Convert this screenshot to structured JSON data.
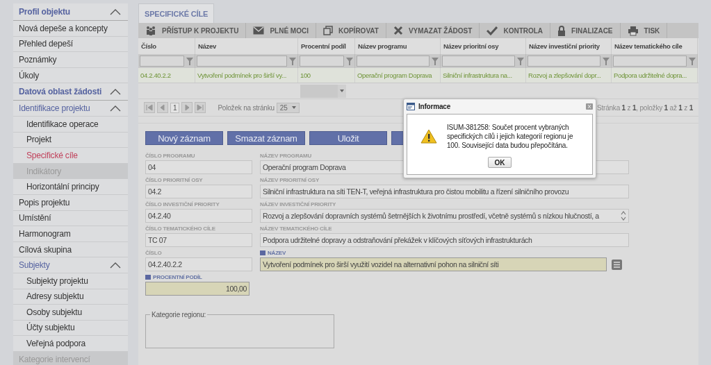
{
  "sidebar": {
    "items": [
      {
        "label": "Profil objektu",
        "kind": "header",
        "expanded": true,
        "children": [
          {
            "label": "Nová depeše a koncepty",
            "selected": false,
            "disabled": false
          },
          {
            "label": "Přehled depeší",
            "selected": false,
            "disabled": false
          },
          {
            "label": "Poznámky",
            "selected": false,
            "disabled": false
          },
          {
            "label": "Úkoly",
            "selected": false,
            "disabled": false
          }
        ]
      },
      {
        "label": "Datová oblast žádosti",
        "kind": "header",
        "expanded": true,
        "children": [
          {
            "label": "Identifikace projektu",
            "kind": "group",
            "expanded": true,
            "children": [
              {
                "label": "Identifikace operace",
                "selected": false,
                "disabled": false
              },
              {
                "label": "Projekt",
                "selected": false,
                "disabled": false
              },
              {
                "label": "Specifické cíle",
                "selected": true,
                "disabled": false
              },
              {
                "label": "Indikátory",
                "selected": false,
                "disabled": true
              },
              {
                "label": "Horizontální principy",
                "selected": false,
                "disabled": false
              }
            ]
          },
          {
            "label": "Popis projektu",
            "selected": false,
            "disabled": false
          },
          {
            "label": "Umístění",
            "selected": false,
            "disabled": false
          },
          {
            "label": "Harmonogram",
            "selected": false,
            "disabled": false
          },
          {
            "label": "Cílová skupina",
            "selected": false,
            "disabled": false
          },
          {
            "label": "Subjekty",
            "kind": "group",
            "expanded": true,
            "children": [
              {
                "label": "Subjekty projektu",
                "selected": false,
                "disabled": false
              },
              {
                "label": "Adresy subjektu",
                "selected": false,
                "disabled": false
              },
              {
                "label": "Osoby subjektu",
                "selected": false,
                "disabled": false
              },
              {
                "label": "Účty subjektu",
                "selected": false,
                "disabled": false
              },
              {
                "label": "Veřejná podpora",
                "selected": false,
                "disabled": false
              }
            ]
          },
          {
            "label": "Kategorie intervencí",
            "selected": false,
            "disabled": true
          }
        ]
      }
    ]
  },
  "tab": {
    "label": "SPECIFICKÉ CÍLE",
    "selected": true
  },
  "toolbar": [
    {
      "label": "PŘÍSTUP K PROJEKTU"
    },
    {
      "label": "PLNÉ MOCI"
    },
    {
      "label": "KOPÍROVAT"
    },
    {
      "label": "VYMAZAT ŽÁDOST"
    },
    {
      "label": "KONTROLA"
    },
    {
      "label": "FINALIZACE"
    },
    {
      "label": "TISK"
    }
  ],
  "table": {
    "columns": [
      "Číslo",
      "Název",
      "Procentní podíl",
      "Název programu",
      "Název prioritní osy",
      "Název investiční priority",
      "Název tematického cíle"
    ],
    "rows": [
      {
        "selected": true,
        "cells": [
          "04.2.40.2.2",
          "Vytvoření podmínek pro širší vy...",
          "100",
          "Operační program Doprava",
          "Silniční infrastruktura na...",
          "Rozvoj a zlepšování dopr...",
          "Podpora udržitelné dopra..."
        ]
      }
    ]
  },
  "pager": {
    "page": "1",
    "page_size_label": "Položek na stránku",
    "page_size": "25",
    "summary": "Stránka **1** z **1**, položky **1** až **1** z **1**"
  },
  "buttons": [
    "Nový záznam",
    "Smazat záznam",
    "Uložit"
  ],
  "form": {
    "rows": [
      [
        {
          "label": "ČÍSLO PROGRAMU",
          "value": "04",
          "required": false,
          "highlighted": false,
          "kind": "text"
        },
        {
          "label": "NÁZEV PROGRAMU",
          "value": "Operační program Doprava",
          "required": false,
          "highlighted": false,
          "kind": "text"
        }
      ],
      [
        {
          "label": "ČÍSLO PRIORITNÍ OSY",
          "value": "04.2",
          "required": false,
          "highlighted": false,
          "kind": "text"
        },
        {
          "label": "NÁZEV PRIORITNÍ OSY",
          "value": "Silniční infrastruktura na síti TEN-T, veřejná infrastruktura pro čistou mobilitu a řízení silničního provozu",
          "required": false,
          "highlighted": false,
          "kind": "text"
        }
      ],
      [
        {
          "label": "ČÍSLO INVESTIČNÍ PRIORITY",
          "value": "04.2.40",
          "required": false,
          "highlighted": false,
          "kind": "text"
        },
        {
          "label": "NÁZEV INVESTIČNÍ PRIORITY",
          "value": "Rozvoj a zlepšování dopravních systémů šetrnějších k životnímu prostředí, včetně systémů s nízkou hlučností, a",
          "required": false,
          "highlighted": false,
          "kind": "textarea"
        }
      ],
      [
        {
          "label": "ČÍSLO TEMATICKÉHO CÍLE",
          "value": "TC 07",
          "required": false,
          "highlighted": false,
          "kind": "text"
        },
        {
          "label": "NÁZEV TEMATICKÉHO CÍLE",
          "value": "Podpora udržitelné dopravy a odstraňování překážek v klíčových síťových infrastrukturách",
          "required": false,
          "highlighted": false,
          "kind": "text"
        }
      ],
      [
        {
          "label": "ČÍSLO",
          "value": "04.2.40.2.2",
          "required": false,
          "highlighted": false,
          "kind": "text"
        },
        {
          "label": "NÁZEV",
          "value": "Vytvoření podmínek pro širší využití vozidel na alternativní pohon na silniční síti",
          "required": true,
          "highlighted": true,
          "kind": "picker"
        }
      ],
      [
        {
          "label": "PROCENTNÍ PODÍL",
          "value": "100,00",
          "required": true,
          "highlighted": true,
          "kind": "number"
        }
      ]
    ],
    "region_group": {
      "legend": "Kategorie regionu:"
    }
  },
  "dialog": {
    "title": "Informace",
    "message": "ISUM-381258: Součet procent vybraných specifických cílů i jejich kategorií regionu je 100. Související data budou přepočítána.",
    "button": "OK"
  }
}
